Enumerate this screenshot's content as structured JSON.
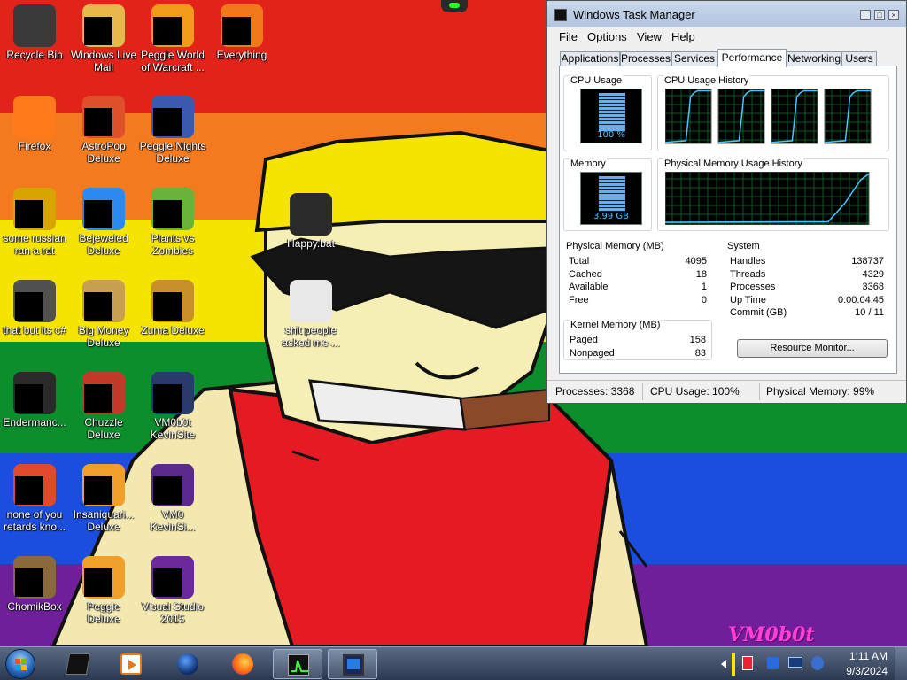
{
  "desktop": {
    "icons": [
      {
        "label": "Recycle Bin",
        "icon": "recycle-bin-icon"
      },
      {
        "label": "Windows Live Mail",
        "icon": "mail-icon"
      },
      {
        "label": "Peggle World of Warcraft ...",
        "icon": "peggle-icon"
      },
      {
        "label": "Everything",
        "icon": "search-icon"
      },
      {
        "label": "Firefox",
        "icon": "firefox-icon"
      },
      {
        "label": "AstroPop Deluxe",
        "icon": "game-icon"
      },
      {
        "label": "Peggle Nights Deluxe",
        "icon": "peggle-icon"
      },
      {
        "label": "some russian ran a rat",
        "icon": "app-icon"
      },
      {
        "label": "Bejeweled Deluxe",
        "icon": "gem-icon"
      },
      {
        "label": "Plants vs Zombies",
        "icon": "plant-icon"
      },
      {
        "label": "that but its c#",
        "icon": "window-icon"
      },
      {
        "label": "Big Money Deluxe",
        "icon": "money-bag-icon"
      },
      {
        "label": "Zuma Deluxe",
        "icon": "idol-icon"
      },
      {
        "label": "Endermanc...",
        "icon": "terminal-icon"
      },
      {
        "label": "Chuzzle Deluxe",
        "icon": "chuzzle-icon"
      },
      {
        "label": "VM0b0t KevinSite",
        "icon": "file-icon"
      },
      {
        "label": "none of you retards kno...",
        "icon": "app-icon"
      },
      {
        "label": "Insaniquari... Deluxe",
        "icon": "fish-icon"
      },
      {
        "label": "VM0 KevinSi...",
        "icon": "file-icon"
      },
      {
        "label": "ChomikBox",
        "icon": "hamster-icon"
      },
      {
        "label": "Peggle Deluxe",
        "icon": "peggle-icon"
      },
      {
        "label": "Visual Studio 2015",
        "icon": "visual-studio-icon"
      },
      {
        "label": "Happy.bat",
        "icon": "batch-file-icon"
      },
      {
        "label": "shit people asked me ...",
        "icon": "folder-icon"
      }
    ]
  },
  "task_manager": {
    "title": "Windows Task Manager",
    "menu": [
      "File",
      "Options",
      "View",
      "Help"
    ],
    "tabs": [
      "Applications",
      "Processes",
      "Services",
      "Performance",
      "Networking",
      "Users"
    ],
    "active_tab": "Performance",
    "cpu_usage": {
      "title": "CPU Usage",
      "value_label": "100 %",
      "level": 1.0
    },
    "cpu_history": {
      "title": "CPU Usage History"
    },
    "memory": {
      "title": "Memory",
      "value_label": "3.99 GB",
      "level": 0.99
    },
    "memory_history": {
      "title": "Physical Memory Usage History"
    },
    "physical_memory": {
      "title": "Physical Memory (MB)",
      "rows": [
        {
          "k": "Total",
          "v": "4095"
        },
        {
          "k": "Cached",
          "v": "18"
        },
        {
          "k": "Available",
          "v": "1"
        },
        {
          "k": "Free",
          "v": "0"
        }
      ]
    },
    "kernel_memory": {
      "title": "Kernel Memory (MB)",
      "rows": [
        {
          "k": "Paged",
          "v": "158"
        },
        {
          "k": "Nonpaged",
          "v": "83"
        }
      ]
    },
    "system": {
      "title": "System",
      "rows": [
        {
          "k": "Handles",
          "v": "138737"
        },
        {
          "k": "Threads",
          "v": "4329"
        },
        {
          "k": "Processes",
          "v": "3368"
        },
        {
          "k": "Up Time",
          "v": "0:00:04:45"
        },
        {
          "k": "Commit (GB)",
          "v": "10 / 11"
        }
      ]
    },
    "resource_monitor_button": "Resource Monitor...",
    "status": {
      "processes": "Processes: 3368",
      "cpu": "CPU Usage: 100%",
      "memory": "Physical Memory: 99%"
    }
  },
  "taskbar": {
    "time": "1:11 AM",
    "date": "9/3/2024",
    "pinned": [
      "console-icon",
      "media-player-icon",
      "globe-icon",
      "firefox-icon",
      "task-manager-icon",
      "remote-desktop-icon"
    ]
  },
  "watermark": "VM0b0t",
  "colors": {
    "graph_line": "#4dc3ff",
    "graph_grid": "#0a5a2a",
    "accent": "#2b3850"
  }
}
